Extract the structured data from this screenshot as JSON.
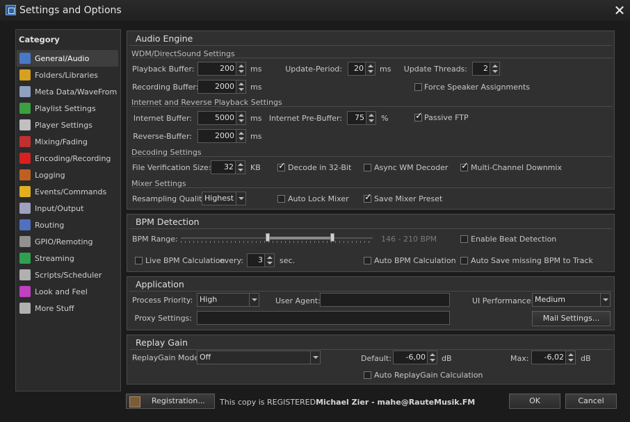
{
  "window": {
    "title": "Settings and Options",
    "close_icon": "close-icon"
  },
  "sidebar": {
    "title": "Category",
    "items": [
      {
        "label": "General/Audio",
        "icon": "music-note-icon",
        "color": "#4a78c8",
        "active": true
      },
      {
        "label": "Folders/Libraries",
        "icon": "folder-icon",
        "color": "#d8a020"
      },
      {
        "label": "Meta Data/WaveFrom",
        "icon": "tags-icon",
        "color": "#8fa0c0"
      },
      {
        "label": "Playlist Settings",
        "icon": "play-icon",
        "color": "#3aa040"
      },
      {
        "label": "Player Settings",
        "icon": "player-icon",
        "color": "#c0c0c0"
      },
      {
        "label": "Mixing/Fading",
        "icon": "crossfade-icon",
        "color": "#c03030"
      },
      {
        "label": "Encoding/Recording",
        "icon": "record-icon",
        "color": "#d82020"
      },
      {
        "label": "Logging",
        "icon": "log-icon",
        "color": "#c06020"
      },
      {
        "label": "Events/Commands",
        "icon": "lightning-icon",
        "color": "#e0b020"
      },
      {
        "label": "Input/Output",
        "icon": "io-icon",
        "color": "#a0a0c0"
      },
      {
        "label": "Routing",
        "icon": "routing-icon",
        "color": "#5070c0"
      },
      {
        "label": "GPIO/Remoting",
        "icon": "gpio-icon",
        "color": "#909090"
      },
      {
        "label": "Streaming",
        "icon": "streaming-icon",
        "color": "#30a050"
      },
      {
        "label": "Scripts/Scheduler",
        "icon": "clock-icon",
        "color": "#b0b0b0"
      },
      {
        "label": "Look and Feel",
        "icon": "palette-icon",
        "color": "#c040c0"
      },
      {
        "label": "More Stuff",
        "icon": "more-icon",
        "color": "#b0b0b0"
      }
    ]
  },
  "audio_engine": {
    "title": "Audio Engine",
    "wdm_section": "WDM/DirectSound Settings",
    "playback_buffer": {
      "label": "Playback Buffer:",
      "value": "200",
      "unit": "ms"
    },
    "recording_buffer": {
      "label": "Recording Buffer:",
      "value": "2000",
      "unit": "ms"
    },
    "update_period": {
      "label": "Update-Period:",
      "value": "20",
      "unit": "ms"
    },
    "update_threads": {
      "label": "Update Threads:",
      "value": "2"
    },
    "force_speaker": {
      "label": "Force Speaker Assignments",
      "checked": false
    },
    "internet_section": "Internet and Reverse Playback Settings",
    "internet_buffer": {
      "label": "Internet Buffer:",
      "value": "5000",
      "unit": "ms"
    },
    "reverse_buffer": {
      "label": "Reverse-Buffer:",
      "value": "2000",
      "unit": "ms"
    },
    "internet_prebuffer": {
      "label": "Internet Pre-Buffer:",
      "value": "75",
      "unit": "%"
    },
    "passive_ftp": {
      "label": "Passive FTP",
      "checked": true
    },
    "decoding_section": "Decoding Settings",
    "file_verification": {
      "label": "File Verification Size:",
      "value": "32",
      "unit": "KB"
    },
    "decode_32bit": {
      "label": "Decode in 32-Bit",
      "checked": true
    },
    "async_wm": {
      "label": "Async WM Decoder",
      "checked": false
    },
    "multichannel": {
      "label": "Multi-Channel Downmix",
      "checked": true
    },
    "mixer_section": "Mixer Settings",
    "resampling_quality": {
      "label": "Resampling Quality:",
      "value": "Highest"
    },
    "auto_lock_mixer": {
      "label": "Auto Lock Mixer",
      "checked": false
    },
    "save_mixer_preset": {
      "label": "Save Mixer Preset",
      "checked": true
    }
  },
  "bpm": {
    "title": "BPM Detection",
    "range_label": "BPM Range:",
    "range_text": "146 - 210 BPM",
    "range_low": 146,
    "range_high": 210,
    "enable_beat_detection": {
      "label": "Enable Beat Detection",
      "checked": false
    },
    "live_bpm": {
      "label": "Live BPM Calculation",
      "checked": false
    },
    "every_label": "every:",
    "every_value": "3",
    "every_unit": "sec.",
    "auto_bpm": {
      "label": "Auto BPM Calculation",
      "checked": false
    },
    "auto_save_bpm": {
      "label": "Auto Save missing BPM to Track",
      "checked": false
    }
  },
  "application": {
    "title": "Application",
    "process_priority": {
      "label": "Process Priority:",
      "value": "High"
    },
    "user_agent": {
      "label": "User Agent:",
      "value": ""
    },
    "ui_performance": {
      "label": "UI Performance:",
      "value": "Medium"
    },
    "proxy_settings": {
      "label": "Proxy Settings:",
      "value": ""
    },
    "mail_settings_button": "Mail Settings..."
  },
  "replay_gain": {
    "title": "Replay Gain",
    "mode": {
      "label": "ReplayGain Mode:",
      "value": "Off"
    },
    "default": {
      "label": "Default:",
      "value": "-6,00",
      "unit": "dB"
    },
    "max": {
      "label": "Max:",
      "value": "-6,02",
      "unit": "dB"
    },
    "auto_calc": {
      "label": "Auto ReplayGain Calculation",
      "checked": false
    }
  },
  "footer": {
    "registration_button": "Registration...",
    "registered_text": "This copy is REGISTERED",
    "registered_user": "Michael Zier - mahe@RauteMusik.FM",
    "ok_button": "OK",
    "cancel_button": "Cancel"
  }
}
